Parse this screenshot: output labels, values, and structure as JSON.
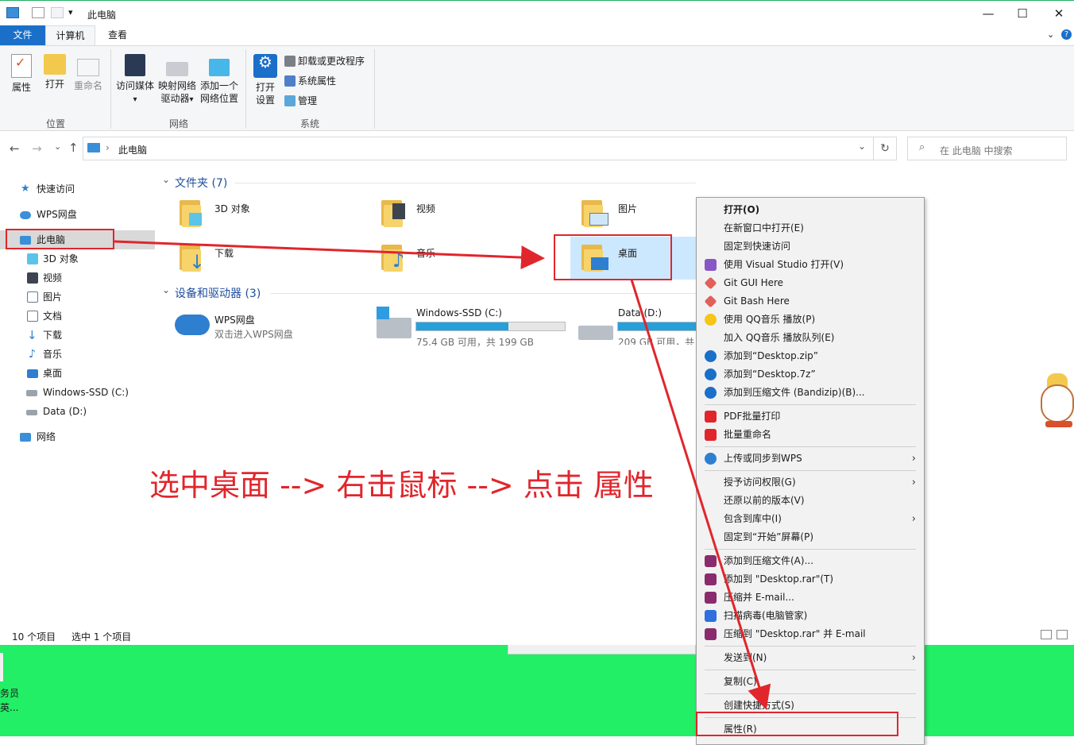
{
  "window": {
    "title": "此电脑",
    "controls": {
      "minimize": "—",
      "maximize": "☐",
      "close": "✕"
    }
  },
  "tabs": {
    "file": "文件",
    "computer": "计算机",
    "view": "查看"
  },
  "ribbon": {
    "groups": {
      "location": "位置",
      "network": "网络",
      "system": "系统"
    },
    "properties": "属性",
    "open": "打开",
    "rename": "重命名",
    "access_media": "访问媒体",
    "map_drive_1": "映射网络",
    "map_drive_2": "驱动器",
    "add_location_1": "添加一个",
    "add_location_2": "网络位置",
    "open_settings_1": "打开",
    "open_settings_2": "设置",
    "uninstall": "卸载或更改程序",
    "system_properties": "系统属性",
    "manage": "管理",
    "dropdown_glyph": "▾"
  },
  "address": {
    "path": "此电脑",
    "separator": "›",
    "dropdown_glyph": "⌄",
    "refresh_glyph": "↻",
    "search_placeholder": "在 此电脑 中搜索",
    "back_glyph": "←",
    "forward_glyph": "→",
    "recent_glyph": "⌄",
    "up_glyph": "↑"
  },
  "nav": {
    "quick_access": "快速访问",
    "wps_cloud": "WPS网盘",
    "this_pc": "此电脑",
    "objects3d": "3D 对象",
    "videos": "视频",
    "pictures": "图片",
    "documents": "文档",
    "downloads": "下载",
    "music": "音乐",
    "desktop": "桌面",
    "drive_c": "Windows-SSD (C:)",
    "drive_d": "Data (D:)",
    "network": "网络"
  },
  "content": {
    "folders_header": "文件夹 (7)",
    "devices_header": "设备和驱动器 (3)",
    "chevron": "⌄",
    "folders": {
      "objects3d": "3D 对象",
      "videos": "视频",
      "pictures": "图片",
      "downloads": "下载",
      "music": "音乐",
      "desktop": "桌面"
    },
    "devices": {
      "wps_name": "WPS网盘",
      "wps_sub": "双击进入WPS网盘",
      "c_name": "Windows-SSD (C:)",
      "c_sub": "75.4 GB 可用，共 199 GB",
      "c_used": 0.62,
      "d_name": "Data (D:)",
      "d_sub": "209 GB 可用，共",
      "d_used": 0.6
    }
  },
  "status": {
    "count": "10 个项目",
    "selected": "选中 1 个项目"
  },
  "desktop_icon": {
    "line1": "务员",
    "line2": "英..."
  },
  "context_menu": {
    "open": "打开(O)",
    "open_new_window": "在新窗口中打开(E)",
    "pin_quick_access": "固定到快速访问",
    "open_vs": "使用 Visual Studio 打开(V)",
    "git_gui": "Git GUI Here",
    "git_bash": "Git Bash Here",
    "qq_play": "使用 QQ音乐 播放(P)",
    "qq_queue": "加入 QQ音乐 播放队列(E)",
    "add_zip": "添加到“Desktop.zip”",
    "add_7z": "添加到“Desktop.7z”",
    "add_bandizip": "添加到压缩文件 (Bandizip)(B)...",
    "pdf_print": "PDF批量打印",
    "batch_rename": "批量重命名",
    "upload_wps": "上传或同步到WPS",
    "grant_access": "授予访问权限(G)",
    "restore_version": "还原以前的版本(V)",
    "include_library": "包含到库中(I)",
    "pin_start": "固定到“开始”屏幕(P)",
    "add_archive": "添加到压缩文件(A)...",
    "add_rar": "添加到 \"Desktop.rar\"(T)",
    "compress_email": "压缩并 E-mail...",
    "scan_virus": "扫描病毒(电脑管家)",
    "compress_rar_email": "压缩到 \"Desktop.rar\" 并 E-mail",
    "send_to": "发送到(N)",
    "copy": "复制(C)",
    "create_shortcut": "创建快捷方式(S)",
    "properties": "属性(R)",
    "submenu_glyph": "›"
  },
  "annotation": "选中桌面 --> 右击鼠标 --> 点击 属性",
  "colors": {
    "accent": "#1a6fc9",
    "annotation_red": "#e0262c",
    "desktop_green": "#22ee66",
    "selection": "#cce8ff"
  }
}
